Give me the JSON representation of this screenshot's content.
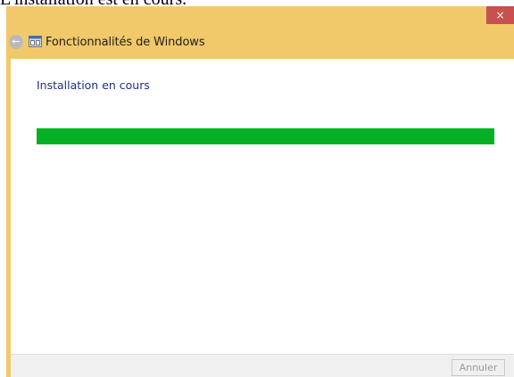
{
  "caption": {
    "text": "L'installation est en cours."
  },
  "window": {
    "title": "Fonctionnalités de Windows",
    "close_glyph": "×",
    "back_glyph": "←",
    "app_icon": "windows-features-icon",
    "accent_color": "#f2c96a"
  },
  "main": {
    "heading": "Installation en cours",
    "progress": {
      "value": 1.0,
      "color": "#06b025"
    }
  },
  "footer": {
    "cancel_label": "Annuler"
  }
}
